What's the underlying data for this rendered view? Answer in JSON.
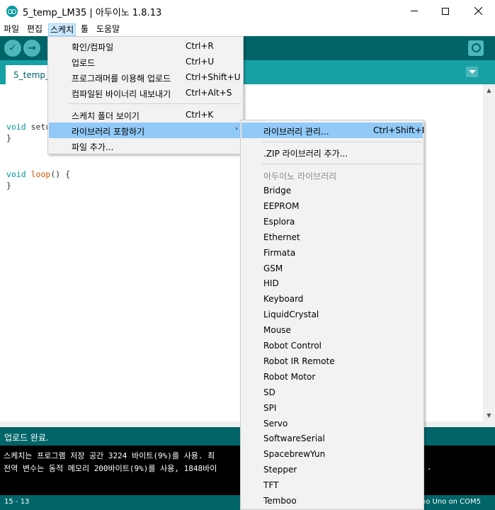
{
  "window": {
    "title": "5_temp_LM35 | 아두이노 1.8.13"
  },
  "menubar": [
    "파일",
    "편집",
    "스케치",
    "툴",
    "도움말"
  ],
  "toolbar": {
    "verify_icon": "✓",
    "upload_icon": "→"
  },
  "tab": {
    "label": "5_temp_L"
  },
  "editor": {
    "lines": [
      {
        "kw": "void",
        "rest": " setu"
      },
      {
        "text": "}"
      },
      {
        "kw": "void",
        "fn": " loop",
        "rest": "() {"
      },
      {
        "text": "}"
      }
    ]
  },
  "sketch_menu": {
    "items": [
      {
        "label": "확인/컴파일",
        "shortcut": "Ctrl+R"
      },
      {
        "label": "업로드",
        "shortcut": "Ctrl+U"
      },
      {
        "label": "프로그래머를 이용해 업로드",
        "shortcut": "Ctrl+Shift+U"
      },
      {
        "label": "컴파일된 바이너리 내보내기",
        "shortcut": "Ctrl+Alt+S"
      },
      {
        "label": "스케치 폴더 보이기",
        "shortcut": "Ctrl+K"
      },
      {
        "label": "라이브러리 포함하기",
        "shortcut": "",
        "arrow": "›"
      },
      {
        "label": "파일 추가...",
        "shortcut": ""
      }
    ]
  },
  "library_submenu": {
    "manage": {
      "label": "라이브러리 관리...",
      "shortcut": "Ctrl+Shift+I"
    },
    "add_zip": {
      "label": ".ZIP 라이브러리 추가..."
    },
    "section_header": "아두이노 라이브러리",
    "libraries": [
      "Bridge",
      "EEPROM",
      "Esplora",
      "Ethernet",
      "Firmata",
      "GSM",
      "HID",
      "Keyboard",
      "LiquidCrystal",
      "Mouse",
      "Robot Control",
      "Robot IR Remote",
      "Robot Motor",
      "SD",
      "SPI",
      "Servo",
      "SoftwareSerial",
      "SpacebrewYun",
      "Stepper",
      "TFT",
      "Temboo"
    ]
  },
  "status": {
    "message": "업로드 완료."
  },
  "console": {
    "line1": "스케치는 프로그램 저장 공간 3224 바이트(9%)를 사용. 최",
    "line2": "전역 변수는 동적 메모리 200바이트(9%)를 사용, 1848바이",
    "line2_tail": "."
  },
  "bottombar": {
    "line_numbers": "15 - 13",
    "board": "no Uno on COM5"
  },
  "colors": {
    "toolbar": "#006468",
    "tabbar": "#17a1a5",
    "highlight": "#91c9f7"
  }
}
